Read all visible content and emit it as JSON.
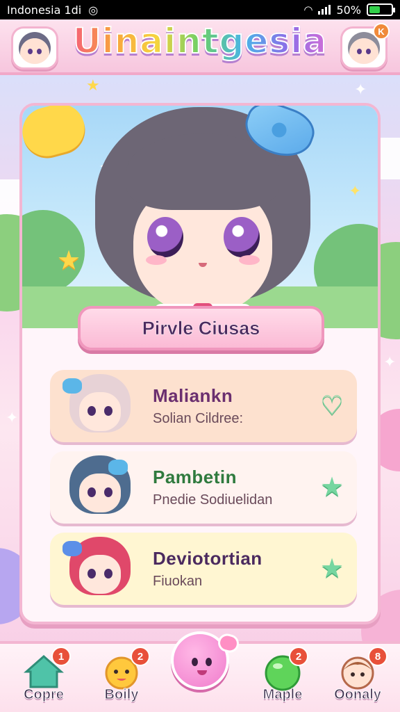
{
  "status_bar": {
    "carrier": "Indonesia 1di",
    "battery": "50%",
    "battery_level": 0.5
  },
  "header": {
    "title": "Uinaintgesia",
    "right_badge": "K"
  },
  "hero": {
    "character_name": "Pirvle Ciusas"
  },
  "list": [
    {
      "title": "Maliankn",
      "subtitle": "Solian Cildree:",
      "icon": "heart-icon",
      "title_color": "#6b2f6f"
    },
    {
      "title": "Pambetin",
      "subtitle": "Pnedie Sodiuelidan",
      "icon": "star-icon",
      "title_color": "#2f7a3e"
    },
    {
      "title": "Deviotortian",
      "subtitle": "Fiuokan",
      "icon": "star-icon",
      "title_color": "#4b2a5f"
    }
  ],
  "nav": [
    {
      "label": "Copre",
      "badge": "1",
      "icon": "house-icon"
    },
    {
      "label": "Boily",
      "badge": "2",
      "icon": "sun-creature-icon"
    },
    {
      "label": "Maple",
      "badge": "2",
      "icon": "green-orb-icon"
    },
    {
      "label": "Oonaly",
      "badge": "8",
      "icon": "character-head-icon"
    }
  ],
  "colors": {
    "accent_pink": "#f3b6d2",
    "star_green": "#76d6a0",
    "badge_red": "#e8503a"
  }
}
